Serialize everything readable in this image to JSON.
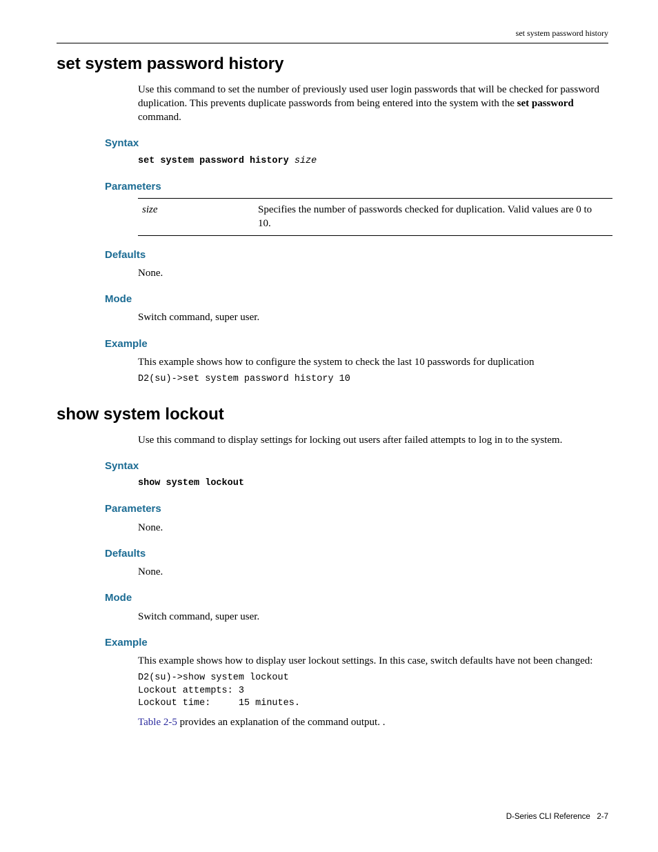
{
  "header": {
    "running": "set system password history"
  },
  "sec1": {
    "title": "set system password history",
    "intro_a": "Use this command to set the number of previously used user login passwords that will be checked for password duplication. This prevents duplicate passwords from being entered into the system with the ",
    "intro_bold": "set password",
    "intro_b": " command.",
    "syn_h": "Syntax",
    "syn_cmd": "set system password history ",
    "syn_arg": "size",
    "par_h": "Parameters",
    "par_key": "size",
    "par_val": "Specifies the number of passwords checked for duplication. Valid values are 0 to 10.",
    "def_h": "Defaults",
    "def_v": "None.",
    "mode_h": "Mode",
    "mode_v": "Switch command, super user.",
    "ex_h": "Example",
    "ex_p": "This example shows how to configure the system to check the last 10 passwords for duplication",
    "ex_code": "D2(su)->set system password history 10"
  },
  "sec2": {
    "title": "show system lockout",
    "intro": "Use this command to display settings for locking out users after failed attempts to log in to the system.",
    "syn_h": "Syntax",
    "syn_cmd": "show system lockout",
    "par_h": "Parameters",
    "par_v": "None.",
    "def_h": "Defaults",
    "def_v": "None.",
    "mode_h": "Mode",
    "mode_v": "Switch command, super user.",
    "ex_h": "Example",
    "ex_p": "This example shows how to display user lockout settings. In this case, switch defaults have not been changed:",
    "ex_code": "D2(su)->show system lockout\nLockout attempts: 3\nLockout time:     15 minutes.",
    "out_link": "Table 2-5",
    "out_rest": " provides an explanation of the command output. ."
  },
  "footer": {
    "book": "D-Series CLI Reference",
    "page": "2-7"
  }
}
